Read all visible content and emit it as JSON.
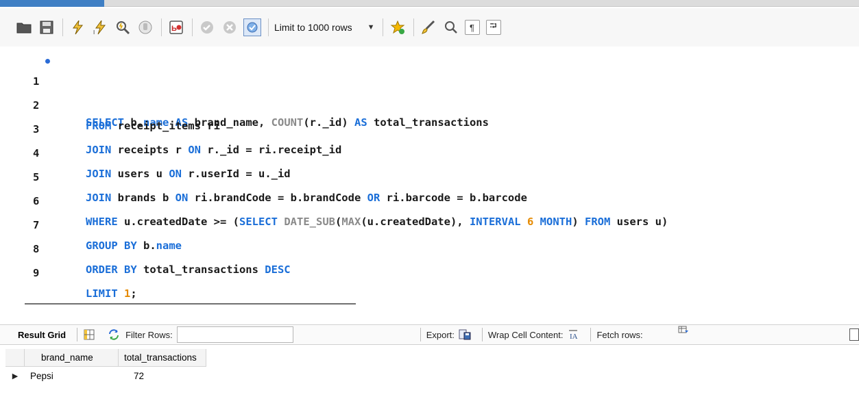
{
  "toolbar": {
    "limit_label": "Limit to 1000 rows",
    "icons": [
      "folder-icon",
      "save-icon",
      "execute-icon",
      "execute-current-icon",
      "explain-icon",
      "stop-icon",
      "toggle-error-icon",
      "commit-icon",
      "rollback-icon",
      "autocommit-icon",
      "beautify-icon",
      "brush-icon",
      "find-icon",
      "invisible-chars-icon",
      "wrap-icon"
    ]
  },
  "editor": {
    "lines": [
      {
        "number": "1"
      },
      {
        "number": "2"
      },
      {
        "number": "3"
      },
      {
        "number": "4"
      },
      {
        "number": "5"
      },
      {
        "number": "6"
      },
      {
        "number": "7"
      },
      {
        "number": "8"
      },
      {
        "number": "9"
      }
    ],
    "t": {
      "l1a": "SELECT",
      "l1b": " b.",
      "l1c": "name",
      "l1d": " ",
      "l1e": "AS",
      "l1f": " brand_name, ",
      "l1g": "COUNT",
      "l1h": "(r._id) ",
      "l1i": "AS",
      "l1j": " total_transactions",
      "l2a": "FROM",
      "l2b": " receipt_items ri",
      "l3a": "JOIN",
      "l3b": " receipts r ",
      "l3c": "ON",
      "l3d": " r._id = ri.receipt_id",
      "l4a": "JOIN",
      "l4b": " users u ",
      "l4c": "ON",
      "l4d": " r.userId = u._id",
      "l5a": "JOIN",
      "l5b": " brands b ",
      "l5c": "ON",
      "l5d": " ri.brandCode = b.brandCode ",
      "l5e": "OR",
      "l5f": " ri.barcode = b.barcode",
      "l6a": "WHERE",
      "l6b": " u.createdDate >= (",
      "l6c": "SELECT",
      "l6d": " ",
      "l6e": "DATE_SUB",
      "l6f": "(",
      "l6g": "MAX",
      "l6h": "(u.createdDate), ",
      "l6i": "INTERVAL",
      "l6j": " ",
      "l6k": "6",
      "l6l": " ",
      "l6m": "MONTH",
      "l6n": ") ",
      "l6o": "FROM",
      "l6p": " users u)",
      "l7a": "GROUP BY",
      "l7b": " b.",
      "l7c": "name",
      "l8a": "ORDER BY",
      "l8b": " total_transactions ",
      "l8c": "DESC",
      "l9a": "LIMIT",
      "l9b": " ",
      "l9c": "1",
      "l9d": ";"
    }
  },
  "result_toolbar": {
    "result_grid": "Result Grid",
    "filter_rows": "Filter Rows:",
    "filter_value": "",
    "export": "Export:",
    "wrap_cell": "Wrap Cell Content:",
    "fetch_rows": "Fetch rows:"
  },
  "grid": {
    "columns": [
      "brand_name",
      "total_transactions"
    ],
    "rows": [
      [
        "Pepsi",
        "72"
      ]
    ]
  },
  "colors": {
    "keyword": "#1a6ed8",
    "function": "#8a8a8a",
    "number": "#e58a00"
  }
}
